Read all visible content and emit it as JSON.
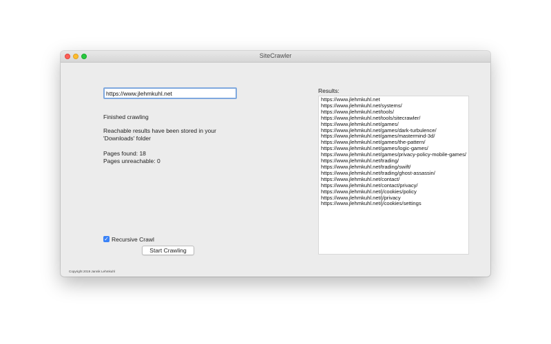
{
  "window": {
    "title": "SiteCrawler"
  },
  "crawler": {
    "url_value": "https://www.jlehmkuhl.net",
    "status": "Finished crawling",
    "stored_line1": "Reachable results have been stored in your",
    "stored_line2": "'Downloads' folder",
    "pages_found": "Pages found: 18",
    "pages_unreachable": "Pages unreachable: 0",
    "recursive_label": "Recursive Crawl",
    "recursive_checked": true,
    "start_button_label": "Start Crawling",
    "copyright": "Copyright 2019 Jannik Lehmkuhl"
  },
  "results": {
    "label": "Results:",
    "items": [
      "https://www.jlehmkuhl.net",
      "https://www.jlehmkuhl.net/systems/",
      "https://www.jlehmkuhl.net/tools/",
      "https://www.jlehmkuhl.net/tools/sitecrawler/",
      "https://www.jlehmkuhl.net/games/",
      "https://www.jlehmkuhl.net/games/dark-turbulence/",
      "https://www.jlehmkuhl.net/games/mastermind-3d/",
      "https://www.jlehmkuhl.net/games/the-pattern/",
      "https://www.jlehmkuhl.net/games/logic-games/",
      "https://www.jlehmkuhl.net/games/privacy-policy-mobile-games/",
      "https://www.jlehmkuhl.net/trading/",
      "https://www.jlehmkuhl.net/trading/swift/",
      "https://www.jlehmkuhl.net/trading/ghost-assassin/",
      "https://www.jlehmkuhl.net/contact/",
      "https://www.jlehmkuhl.net/contact/privacy/",
      "https://www.jlehmkuhl.net/j/cookies/policy",
      "https://www.jlehmkuhl.net/j/privacy",
      "https://www.jlehmkuhl.net/j/cookies/settings"
    ]
  },
  "colors": {
    "accent": "#3a82f7",
    "focus_ring": "#7fa8de",
    "close": "#fd5f57",
    "minimize": "#febc2e",
    "zoom": "#28c840"
  }
}
